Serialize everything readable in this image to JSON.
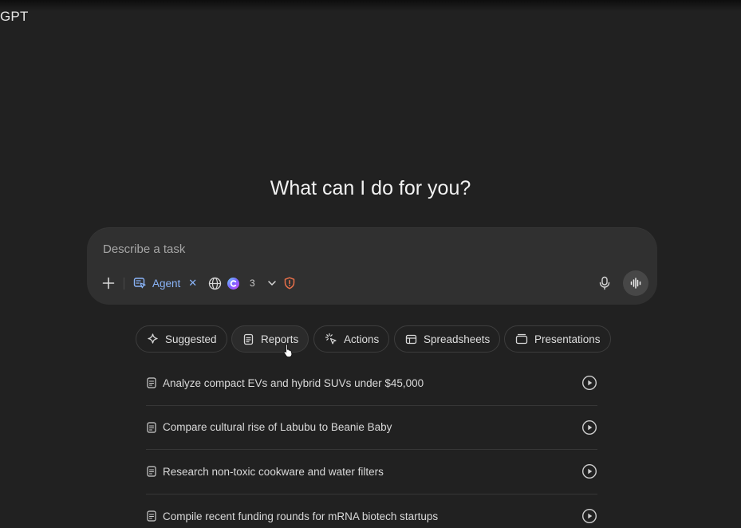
{
  "app": {
    "title": "GPT"
  },
  "main": {
    "headline": "What can I do for you?"
  },
  "composer": {
    "placeholder": "Describe a task",
    "agent_label": "Agent",
    "tools_count": "3"
  },
  "chips": [
    {
      "label": "Suggested",
      "icon": "sparkle-icon"
    },
    {
      "label": "Reports",
      "icon": "document-icon",
      "active": true
    },
    {
      "label": "Actions",
      "icon": "click-icon"
    },
    {
      "label": "Spreadsheets",
      "icon": "table-icon"
    },
    {
      "label": "Presentations",
      "icon": "slides-icon"
    }
  ],
  "suggestions": [
    {
      "text": "Analyze compact EVs and hybrid SUVs under $45,000"
    },
    {
      "text": "Compare cultural rise of Labubu to Beanie Baby"
    },
    {
      "text": "Research non-toxic cookware and water filters"
    },
    {
      "text": "Compile recent funding rounds for mRNA biotech startups"
    }
  ],
  "colors": {
    "background": "#212121",
    "composer": "#303030",
    "accent": "#8ab4f8",
    "shield": "#e8704a"
  }
}
